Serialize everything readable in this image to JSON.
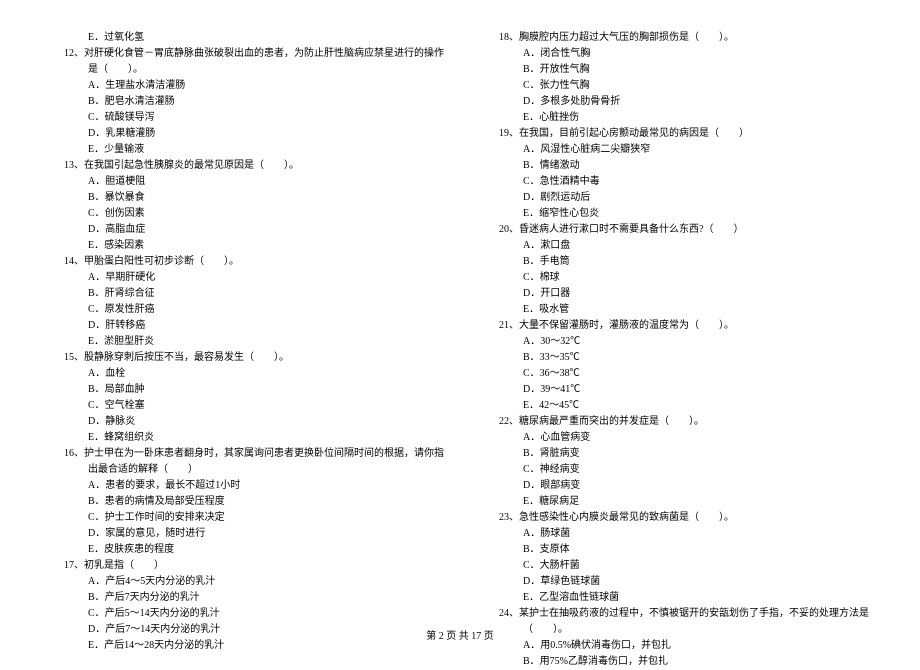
{
  "left": {
    "q11_optE": "E．过氧化氢",
    "q12": "12、对肝硬化食管－胃底静脉曲张破裂出血的患者，为防止肝性脑病应禁星进行的操作是（　　）。",
    "q12_opts": [
      "A．生理盐水清洁灌肠",
      "B．肥皂水清洁灌肠",
      "C．硫酸镁导泻",
      "D．乳果糖灌肠",
      "E．少量输液"
    ],
    "q13": "13、在我国引起急性胰腺炎的最常见原因是（　　）。",
    "q13_opts": [
      "A．胆道梗阻",
      "B．暴饮暴食",
      "C．创伤因素",
      "D．高脂血症",
      "E．感染因素"
    ],
    "q14": "14、甲胎蛋白阳性可初步诊断（　　）。",
    "q14_opts": [
      "A．早期肝硬化",
      "B．肝肾综合征",
      "C．原发性肝癌",
      "D．肝转移癌",
      "E．淤胆型肝炎"
    ],
    "q15": "15、股静脉穿刺后按压不当，最容易发生（　　）。",
    "q15_opts": [
      "A．血栓",
      "B．局部血肿",
      "C．空气栓塞",
      "D．静脉炎",
      "E．蜂窝组织炎"
    ],
    "q16": "16、护士甲在为一卧床患者翻身时，其家属询问患者更换卧位间隔时间的根据，请你指出最合适的解释（　　）",
    "q16_opts": [
      "A．患者的要求，最长不超过1小时",
      "B．患者的病情及局部受压程度",
      "C．护士工作时间的安排来决定",
      "D．家属的意见，随时进行",
      "E．皮肤疾患的程度"
    ],
    "q17": "17、初乳是指（　　）",
    "q17_opts": [
      "A．产后4～5天内分泌的乳汁",
      "B．产后7天内分泌的乳汁",
      "C．产后5～14天内分泌的乳汁",
      "D．产后7～14天内分泌的乳汁",
      "E．产后14～28天内分泌的乳汁"
    ]
  },
  "right": {
    "q18": "18、胸膜腔内压力超过大气压的胸部损伤是（　　）。",
    "q18_opts": [
      "A．闭合性气胸",
      "B．开放性气胸",
      "C．张力性气胸",
      "D．多根多处肋骨骨折",
      "E．心脏挫伤"
    ],
    "q19": "19、在我国，目前引起心房颤动最常见的病因是（　　）",
    "q19_opts": [
      "A．风湿性心脏病二尖瓣狭窄",
      "B．情绪激动",
      "C．急性酒精中毒",
      "D．剧烈运动后",
      "E．缩窄性心包炎"
    ],
    "q20": "20、昏迷病人进行漱口时不需要具备什么东西?（　　）",
    "q20_opts": [
      "A．漱口盘",
      "B．手电筒",
      "C．棉球",
      "D．开口器",
      "E．吸水管"
    ],
    "q21": "21、大量不保留灌肠时，灌肠液的温度常为（　　）。",
    "q21_opts": [
      "A．30～32℃",
      "B．33～35℃",
      "C．36～38℃",
      "D．39～41℃",
      "E．42～45℃"
    ],
    "q22": "22、糖尿病最严重而突出的并发症是（　　）。",
    "q22_opts": [
      "A．心血管病变",
      "B．肾脏病变",
      "C．神经病变",
      "D．眼部病变",
      "E．糖尿病足"
    ],
    "q23": "23、急性感染性心内膜炎最常见的致病菌是（　　）。",
    "q23_opts": [
      "A．肠球菌",
      "B．支原体",
      "C．大肠杆菌",
      "D．草绿色链球菌",
      "E．乙型溶血性链球菌"
    ],
    "q24": "24、某护士在抽吸药液的过程中，不慎被锯开的安瓿划伤了手指，不妥的处理方法是（　　）。",
    "q24_opts": [
      "A．用0.5%碘伏消毒伤口，并包扎",
      "B．用75%乙醇消毒伤口，并包扎"
    ]
  },
  "footer": "第 2 页 共 17 页"
}
